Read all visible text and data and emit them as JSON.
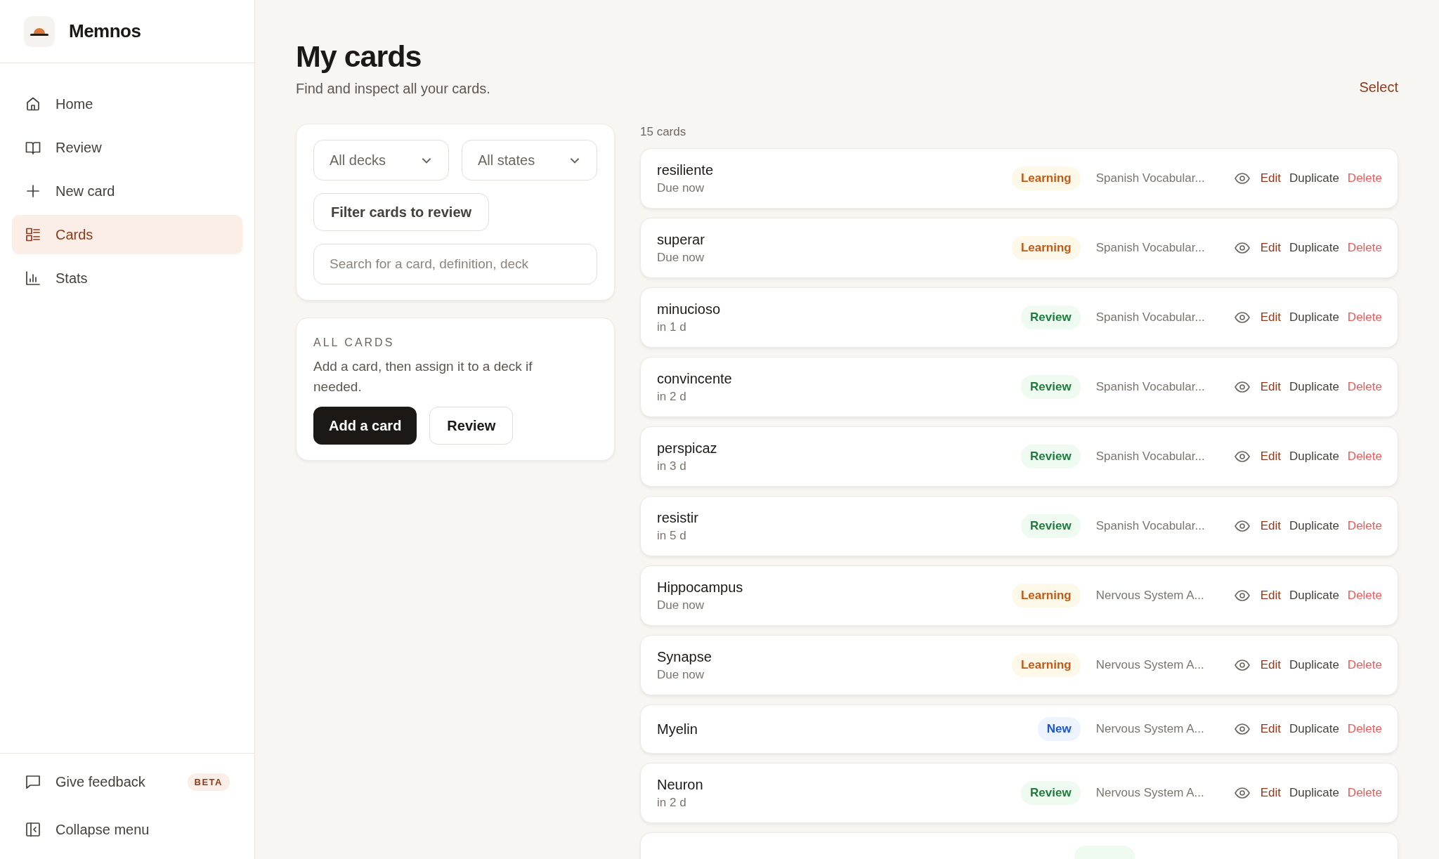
{
  "app": {
    "name": "Memnos"
  },
  "sidebar": {
    "items": [
      {
        "label": "Home",
        "selected": false
      },
      {
        "label": "Review",
        "selected": false
      },
      {
        "label": "New card",
        "selected": false
      },
      {
        "label": "Cards",
        "selected": true
      },
      {
        "label": "Stats",
        "selected": false
      }
    ],
    "footer": [
      {
        "label": "Give feedback",
        "badge": "BETA"
      },
      {
        "label": "Collapse menu"
      }
    ]
  },
  "page": {
    "title": "My cards",
    "subtitle": "Find and inspect all your cards.",
    "action": "Select"
  },
  "filters": {
    "decks": "All decks",
    "states": "All states",
    "review_filter": "Filter cards to review",
    "search": {
      "placeholder": "Search for a card, definition, deck"
    }
  },
  "all_cards": {
    "heading": "ALL CARDS",
    "text": "Add a card, then assign it to a deck if needed.",
    "buttons": [
      {
        "label": "Add a card",
        "kind": "primary"
      },
      {
        "label": "Review",
        "kind": "secondary"
      }
    ]
  },
  "count": "15 cards",
  "cards": [
    {
      "name": "resiliente",
      "due": "Due now",
      "kind": "learning",
      "badge": "Learning",
      "deck": "Spanish Vocabular...",
      "actions": [
        "Edit",
        "Duplicate",
        "Delete"
      ]
    },
    {
      "name": "superar",
      "due": "Due now",
      "kind": "learning",
      "badge": "Learning",
      "deck": "Spanish Vocabular...",
      "actions": [
        "Edit",
        "Duplicate",
        "Delete"
      ]
    },
    {
      "name": "minucioso",
      "due": "in 1 d",
      "kind": "review",
      "badge": "Review",
      "deck": "Spanish Vocabular...",
      "actions": [
        "Edit",
        "Duplicate",
        "Delete"
      ]
    },
    {
      "name": "convincente",
      "due": "in 2 d",
      "kind": "review",
      "badge": "Review",
      "deck": "Spanish Vocabular...",
      "actions": [
        "Edit",
        "Duplicate",
        "Delete"
      ]
    },
    {
      "name": "perspicaz",
      "due": "in 3 d",
      "kind": "review",
      "badge": "Review",
      "deck": "Spanish Vocabular...",
      "actions": [
        "Edit",
        "Duplicate",
        "Delete"
      ]
    },
    {
      "name": "resistir",
      "due": "in 5 d",
      "kind": "review",
      "badge": "Review",
      "deck": "Spanish Vocabular...",
      "actions": [
        "Edit",
        "Duplicate",
        "Delete"
      ]
    },
    {
      "name": "Hippocampus",
      "due": "Due now",
      "kind": "learning",
      "badge": "Learning",
      "deck": "Nervous System A...",
      "actions": [
        "Edit",
        "Duplicate",
        "Delete"
      ]
    },
    {
      "name": "Synapse",
      "due": "Due now",
      "kind": "learning",
      "badge": "Learning",
      "deck": "Nervous System A...",
      "actions": [
        "Edit",
        "Duplicate",
        "Delete"
      ]
    },
    {
      "name": "Myelin",
      "kind": "new",
      "badge": "New",
      "deck": "Nervous System A...",
      "actions": [
        "Edit",
        "Duplicate",
        "Delete"
      ]
    },
    {
      "name": "Neuron",
      "due": "in 2 d",
      "kind": "review",
      "badge": "Review",
      "deck": "Nervous System A...",
      "actions": [
        "Edit",
        "Duplicate",
        "Delete"
      ]
    },
    {
      "kind": "review"
    }
  ]
}
